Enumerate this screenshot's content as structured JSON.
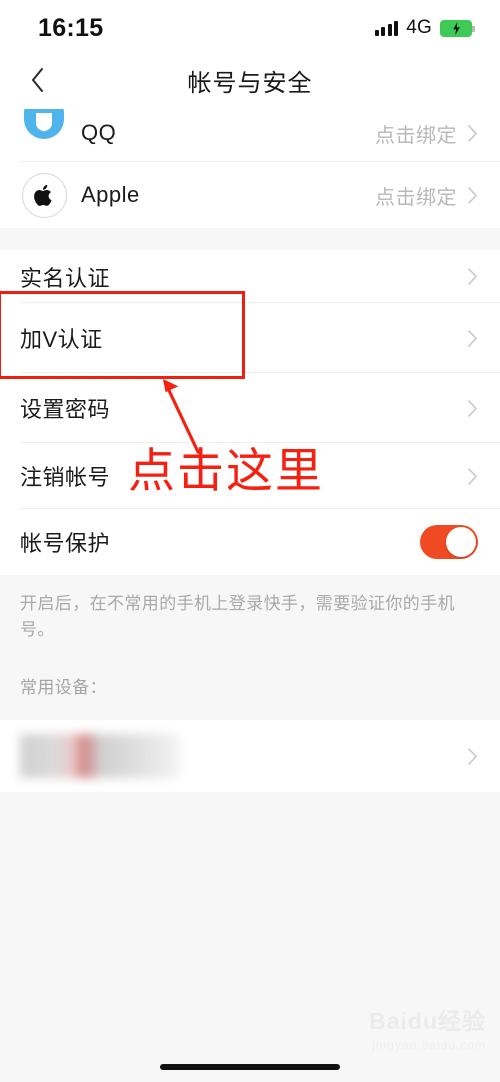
{
  "status_bar": {
    "time": "16:15",
    "network": "4G",
    "signal_icon": "signal-bars-icon",
    "battery_icon": "battery-charging-icon"
  },
  "nav": {
    "back_icon": "chevron-left-icon",
    "title": "帐号与安全"
  },
  "accounts": [
    {
      "icon": "qq-logo-icon",
      "label": "QQ",
      "value": "点击绑定",
      "chevron": "chevron-right-icon"
    },
    {
      "icon": "apple-logo-icon",
      "label": "Apple",
      "value": "点击绑定",
      "chevron": "chevron-right-icon"
    }
  ],
  "settings": [
    {
      "label": "实名认证",
      "value": "",
      "chevron": "chevron-right-icon"
    },
    {
      "label": "加V认证",
      "value": "",
      "chevron": "chevron-right-icon"
    },
    {
      "label": "设置密码",
      "value": "",
      "chevron": "chevron-right-icon"
    },
    {
      "label": "注销帐号",
      "value": "",
      "chevron": "chevron-right-icon"
    }
  ],
  "protection": {
    "label": "帐号保护",
    "toggle_state": "on",
    "toggle_color": "#f04a23",
    "description": "开启后，在不常用的手机上登录快手，需要验证你的手机号。"
  },
  "devices": {
    "label": "常用设备：",
    "item_masked": "",
    "chevron": "chevron-right-icon"
  },
  "annotation": {
    "highlight_color": "#f01e10",
    "text": "点击这里",
    "arrow_icon": "arrow-up-left-icon",
    "box_target": "加V认证"
  },
  "watermark": {
    "brand": "Baidu经验",
    "url": "jingyan.baidu.com"
  },
  "home_indicator": "home-bar"
}
